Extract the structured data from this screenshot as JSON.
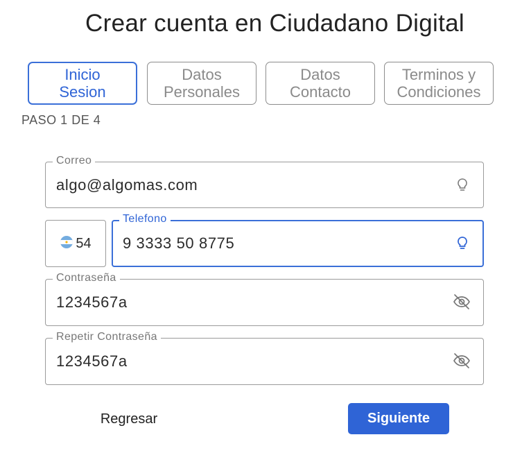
{
  "title": "Crear cuenta en Ciudadano Digital",
  "steps": [
    {
      "line1": "Inicio",
      "line2": "Sesion",
      "active": true
    },
    {
      "line1": "Datos",
      "line2": "Personales",
      "active": false
    },
    {
      "line1": "Datos",
      "line2": "Contacto",
      "active": false
    },
    {
      "line1": "Terminos y",
      "line2": "Condiciones",
      "active": false
    }
  ],
  "step_indicator": "PASO 1 DE 4",
  "form": {
    "email": {
      "label": "Correo",
      "value": "algo@algomas.com",
      "icon": "lightbulb-icon"
    },
    "phone_prefix": {
      "flag": "argentina-flag-icon",
      "code": "54"
    },
    "phone": {
      "label": "Telefono",
      "value": "9 3333 50 8775",
      "icon": "lightbulb-icon"
    },
    "password": {
      "label": "Contraseña",
      "value": "1234567a",
      "icon": "eye-off-icon"
    },
    "password_repeat": {
      "label": "Repetir Contraseña",
      "value": "1234567a",
      "icon": "eye-off-icon"
    }
  },
  "buttons": {
    "back": "Regresar",
    "next": "Siguiente"
  },
  "colors": {
    "accent": "#2f64d6",
    "border": "#9a9a9a",
    "muted_text": "#8a8a8a"
  }
}
